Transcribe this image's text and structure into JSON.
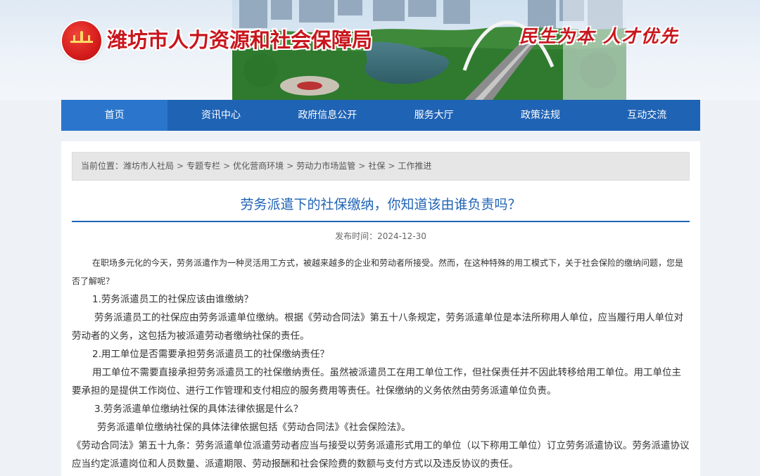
{
  "header": {
    "site_title": "潍坊市人力资源和社会保障局",
    "slogan": "民生为本 人才优先",
    "emblem_text": "民生为本 人才优先"
  },
  "nav": {
    "items": [
      {
        "label": "首页"
      },
      {
        "label": "资讯中心"
      },
      {
        "label": "政府信息公开"
      },
      {
        "label": "服务大厅"
      },
      {
        "label": "政策法规"
      },
      {
        "label": "互动交流"
      }
    ]
  },
  "breadcrumb": {
    "prefix": "当前位置：",
    "items": [
      "潍坊市人社局",
      "专题专栏",
      "优化营商环境",
      "劳动力市场监管",
      "社保",
      "工作推进"
    ],
    "sep": ">"
  },
  "article": {
    "title": "劳务派遣下的社保缴纳，你知道该由谁负责吗？",
    "date": "发布时间：2024-12-30",
    "paragraphs": [
      "在职场多元化的今天，劳务派遣作为一种灵活用工方式，被越来越多的企业和劳动者所接受。然而，在这种特殊的用工模式下，关于社会保险的缴纳问题，您是否了解呢？",
      "1.劳务派遣员工的社保应该由谁缴纳？",
      "劳务派遣员工的社保应由劳务派遣单位缴纳。根据《劳动合同法》第五十八条规定，劳务派遣单位是本法所称用人单位，应当履行用人单位对劳动者的义务，这包括为被派遣劳动者缴纳社保的责任。",
      "2.用工单位是否需要承担劳务派遣员工的社保缴纳责任？",
      "用工单位不需要直接承担劳务派遣员工的社保缴纳责任。虽然被派遣员工在用工单位工作，但社保责任并不因此转移给用工单位。用工单位主要承担的是提供工作岗位、进行工作管理和支付相应的服务费用等责任。社保缴纳的义务依然由劳务派遣单位负责。",
      "3.劳务派遣单位缴纳社保的具体法律依据是什么？",
      "劳务派遣单位缴纳社保的具体法律依据包括《劳动合同法》《社会保险法》。",
      "《劳动合同法》第五十九条：劳务派遣单位派遣劳动者应当与接受以劳务派遣形式用工的单位（以下称用工单位）订立劳务派遣协议。劳务派遣协议应当约定派遣岗位和人员数量、派遣期限、劳动报酬和社会保险费的数额与支付方式以及违反协议的责任。"
    ]
  },
  "colors": {
    "brand_red": "#c8161d",
    "nav_blue": "#1f63b5",
    "title_blue": "#1f63b5"
  }
}
